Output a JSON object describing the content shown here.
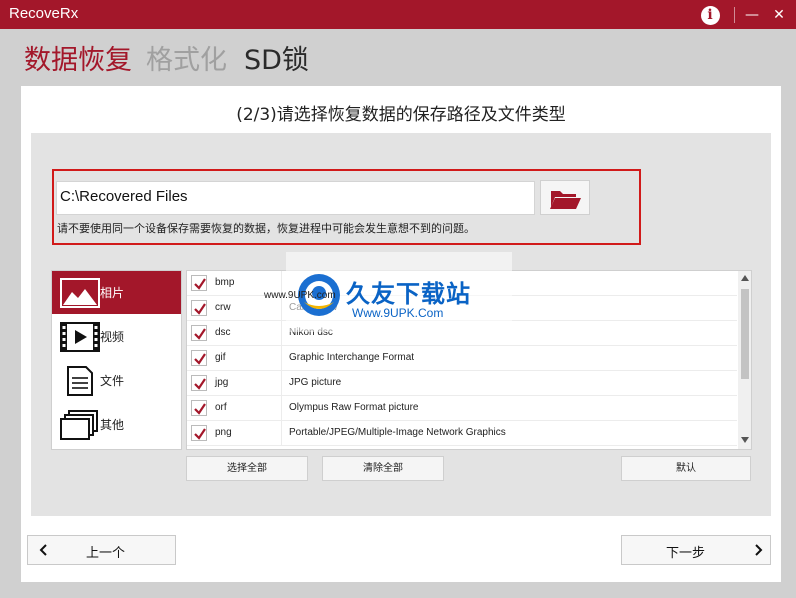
{
  "window": {
    "title": "RecoveRx"
  },
  "titlebar": {
    "info_icon": "info-icon",
    "minimize_icon": "minimize-icon",
    "close_icon": "close-icon",
    "info_glyph": "i",
    "minimize_glyph": "—",
    "close_glyph": "✕"
  },
  "modes": [
    {
      "label": "数据恢复",
      "active": true
    },
    {
      "label": "格式化",
      "active": false
    },
    {
      "label": "SD锁",
      "active": false
    }
  ],
  "step_title": "(2/3)请选择恢复数据的保存路径及文件类型",
  "path": {
    "value": "C:\\Recovered Files",
    "browse_icon": "folder-open-icon",
    "warning": "请不要使用同一个设备保存需要恢复的数据，恢复进程中可能会发生意想不到的问题。"
  },
  "categories": [
    {
      "label": "相片",
      "icon": "photo-icon",
      "active": true
    },
    {
      "label": "视频",
      "icon": "video-icon",
      "active": false
    },
    {
      "label": "文件",
      "icon": "document-icon",
      "active": false
    },
    {
      "label": "其他",
      "icon": "other-icon",
      "active": false
    }
  ],
  "file_types": [
    {
      "ext": "bmp",
      "desc": "",
      "checked": true
    },
    {
      "ext": "crw",
      "desc": "Canon raw",
      "checked": true
    },
    {
      "ext": "dsc",
      "desc": "Nikon dsc",
      "checked": true
    },
    {
      "ext": "gif",
      "desc": "Graphic Interchange Format",
      "checked": true
    },
    {
      "ext": "jpg",
      "desc": "JPG picture",
      "checked": true
    },
    {
      "ext": "orf",
      "desc": "Olympus Raw Format picture",
      "checked": true
    },
    {
      "ext": "png",
      "desc": "Portable/JPEG/Multiple-Image Network Graphics",
      "checked": true
    }
  ],
  "buttons": {
    "select_all": "选择全部",
    "clear_all": "清除全部",
    "default": "默认"
  },
  "nav": {
    "prev": "上一个",
    "next": "下一步"
  },
  "watermark": {
    "name": "久友下载站",
    "url": "Www.9UPK.Com",
    "faint": "www.9UPK.com"
  },
  "colors": {
    "brand": "#a3172a",
    "highlight_border": "#d11a1a",
    "watermark": "#0a63c5"
  }
}
